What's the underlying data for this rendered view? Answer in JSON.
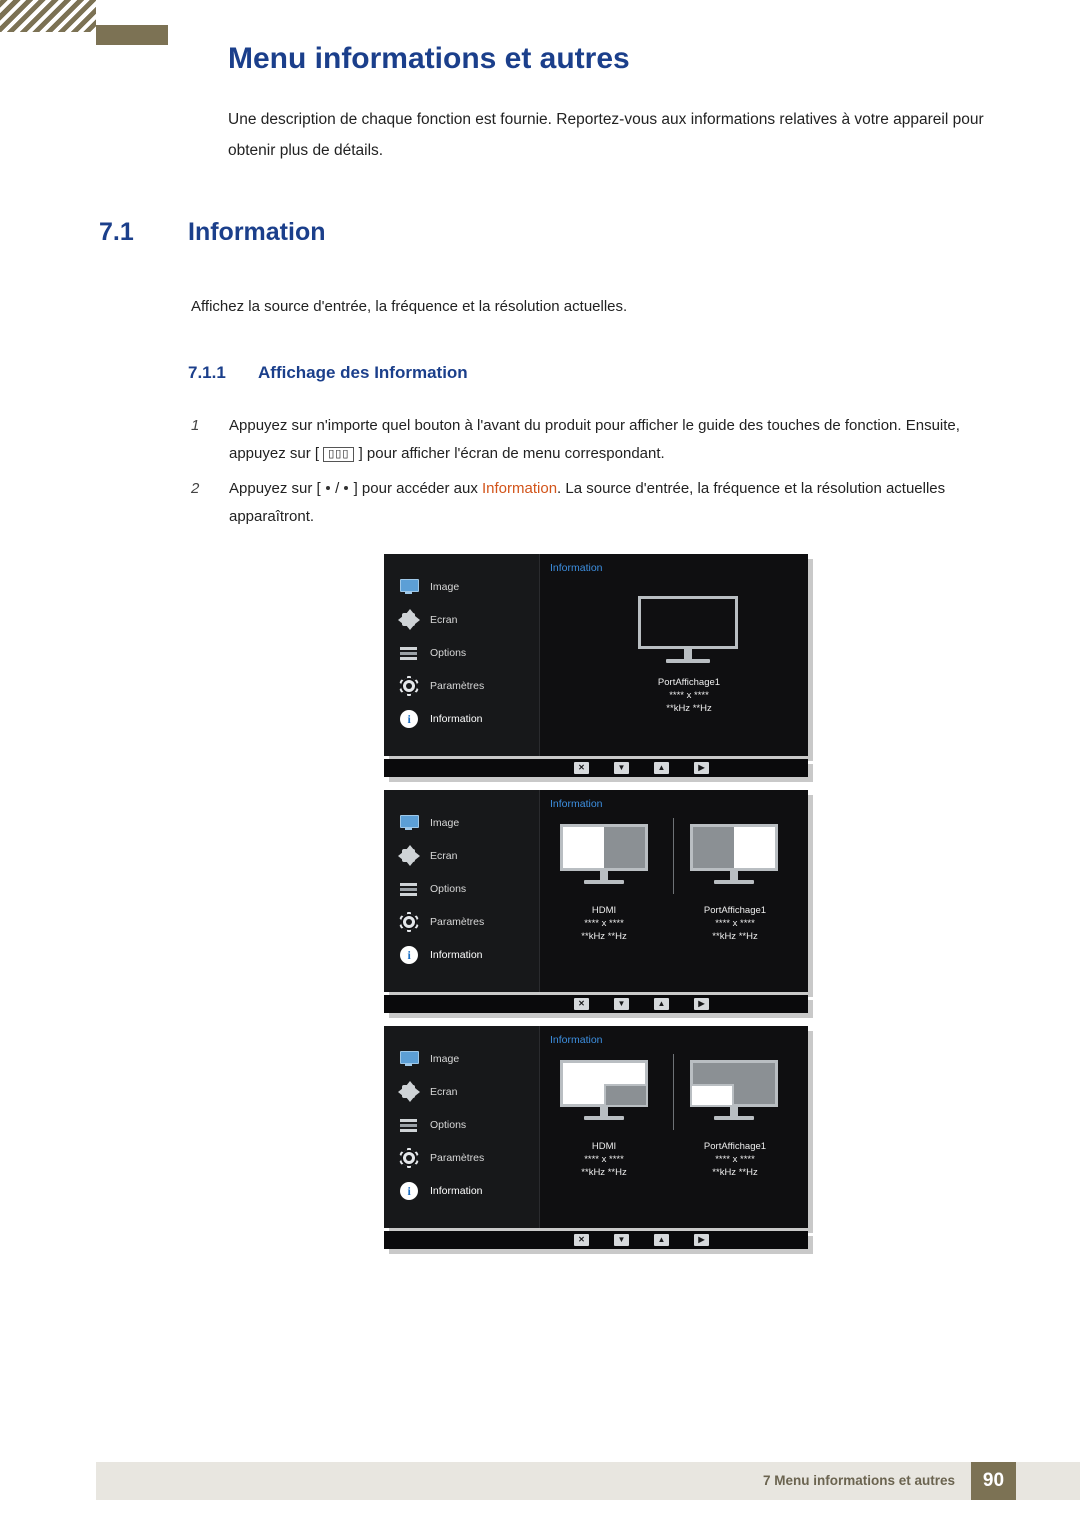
{
  "header": {
    "title": "Menu informations et autres"
  },
  "intro": "Une description de chaque fonction est fournie. Reportez-vous aux informations relatives à votre appareil pour obtenir plus de détails.",
  "section": {
    "number": "7.1",
    "title": "Information",
    "description": "Affichez la source d'entrée, la fréquence et la résolution actuelles."
  },
  "subsection": {
    "number": "7.1.1",
    "title": "Affichage des Information"
  },
  "steps": [
    {
      "num": "1",
      "part1": "Appuyez sur n'importe quel bouton à l'avant du produit pour afficher le guide des touches de fonction. Ensuite, appuyez sur [",
      "button_glyph": "▯▯▯",
      "part2": "] pour afficher l'écran de menu correspondant."
    },
    {
      "num": "2",
      "part1": "Appuyez sur [",
      "sep": "/",
      "part2": "] pour accéder aux ",
      "keyword": "Information",
      "part3": ". La source d'entrée, la fréquence et la résolution actuelles apparaîtront."
    }
  ],
  "osd": {
    "menu_items": [
      {
        "label": "Image",
        "icon": "monitor-icon"
      },
      {
        "label": "Ecran",
        "icon": "arrows-icon"
      },
      {
        "label": "Options",
        "icon": "lines-icon"
      },
      {
        "label": "Paramètres",
        "icon": "gear-icon"
      },
      {
        "label": "Information",
        "icon": "info-icon"
      }
    ],
    "panel_title": "Information",
    "keys": [
      "✕",
      "▼",
      "▲",
      "▶"
    ],
    "figures": [
      {
        "id": "osd-single-source",
        "sources": [
          {
            "name": "PortAffichage1",
            "resolution": "**** x ****",
            "frequency": "**kHz **Hz"
          }
        ]
      },
      {
        "id": "osd-dual-source",
        "sources": [
          {
            "name": "HDMI",
            "resolution": "**** x ****",
            "frequency": "**kHz **Hz"
          },
          {
            "name": "PortAffichage1",
            "resolution": "**** x ****",
            "frequency": "**kHz **Hz"
          }
        ]
      },
      {
        "id": "osd-dual-source-pip",
        "sources": [
          {
            "name": "HDMI",
            "resolution": "**** x ****",
            "frequency": "**kHz **Hz"
          },
          {
            "name": "PortAffichage1",
            "resolution": "**** x ****",
            "frequency": "**kHz **Hz"
          }
        ]
      }
    ]
  },
  "footer": {
    "text": "7 Menu informations et autres",
    "page": "90"
  },
  "colors": {
    "brand_blue": "#1b3f8b",
    "accent_olive": "#7c7254",
    "keyword_orange": "#d2541a",
    "osd_header_blue": "#3d8fe0"
  }
}
